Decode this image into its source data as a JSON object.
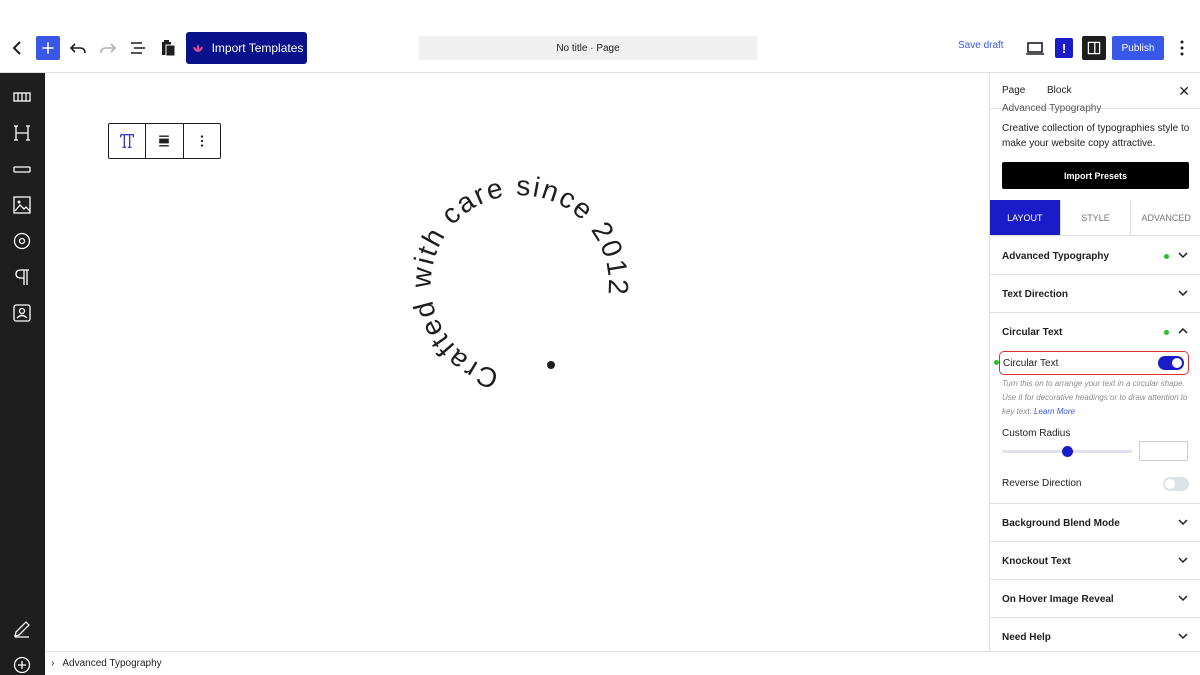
{
  "topbar": {
    "import_label": "Import Templates",
    "doc_title": "No title · Page",
    "save_draft": "Save draft",
    "notice_glyph": "!",
    "publish": "Publish"
  },
  "left_sidebar": {
    "icons": [
      "layout-icon",
      "heading-icon",
      "divider-icon",
      "image-icon",
      "circle-icon",
      "paragraph-icon",
      "contact-icon",
      "edit-icon",
      "add-icon"
    ]
  },
  "canvas": {
    "block_toolbar": {
      "items": [
        "typography-icon",
        "align-icon",
        "more-options-icon"
      ]
    },
    "circular_text": "Crafted with care since 2012"
  },
  "footer": {
    "breadcrumb": "Advanced Typography"
  },
  "panel": {
    "tabs": [
      "Page",
      "Block"
    ],
    "block_title": "Advanced Typography",
    "block_description": "Creative collection of typographies style to make your website copy attractive.",
    "import_presets": "Import Presets",
    "main_tabs": [
      "LAYOUT",
      "STYLE",
      "ADVANCED"
    ],
    "active_tab": "LAYOUT",
    "sections": {
      "advanced_typography": "Advanced Typography",
      "text_direction": "Text Direction",
      "circular_text": "Circular Text",
      "background_blend_mode": "Background Blend Mode",
      "knockout_text": "Knockout Text",
      "on_hover_image_reveal": "On Hover Image Reveal",
      "need_help": "Need Help"
    },
    "circular_text_settings": {
      "toggle_label": "Circular Text",
      "toggle_on": true,
      "help_text": "Turn this on to arrange your text in a circular shape. Use it for decorative headings or to draw attention to key text.",
      "learn_more": "Learn More",
      "radius_label": "Custom Radius",
      "radius_value": 0.5,
      "radius_input": "",
      "reverse_label": "Reverse Direction",
      "reverse_on": false
    }
  },
  "colors": {
    "accent": "#3858e9",
    "brand_dark": "#09128a",
    "tab_active": "#1b1cc9",
    "dot_green": "#27c127",
    "highlight_red": "#e03131"
  }
}
